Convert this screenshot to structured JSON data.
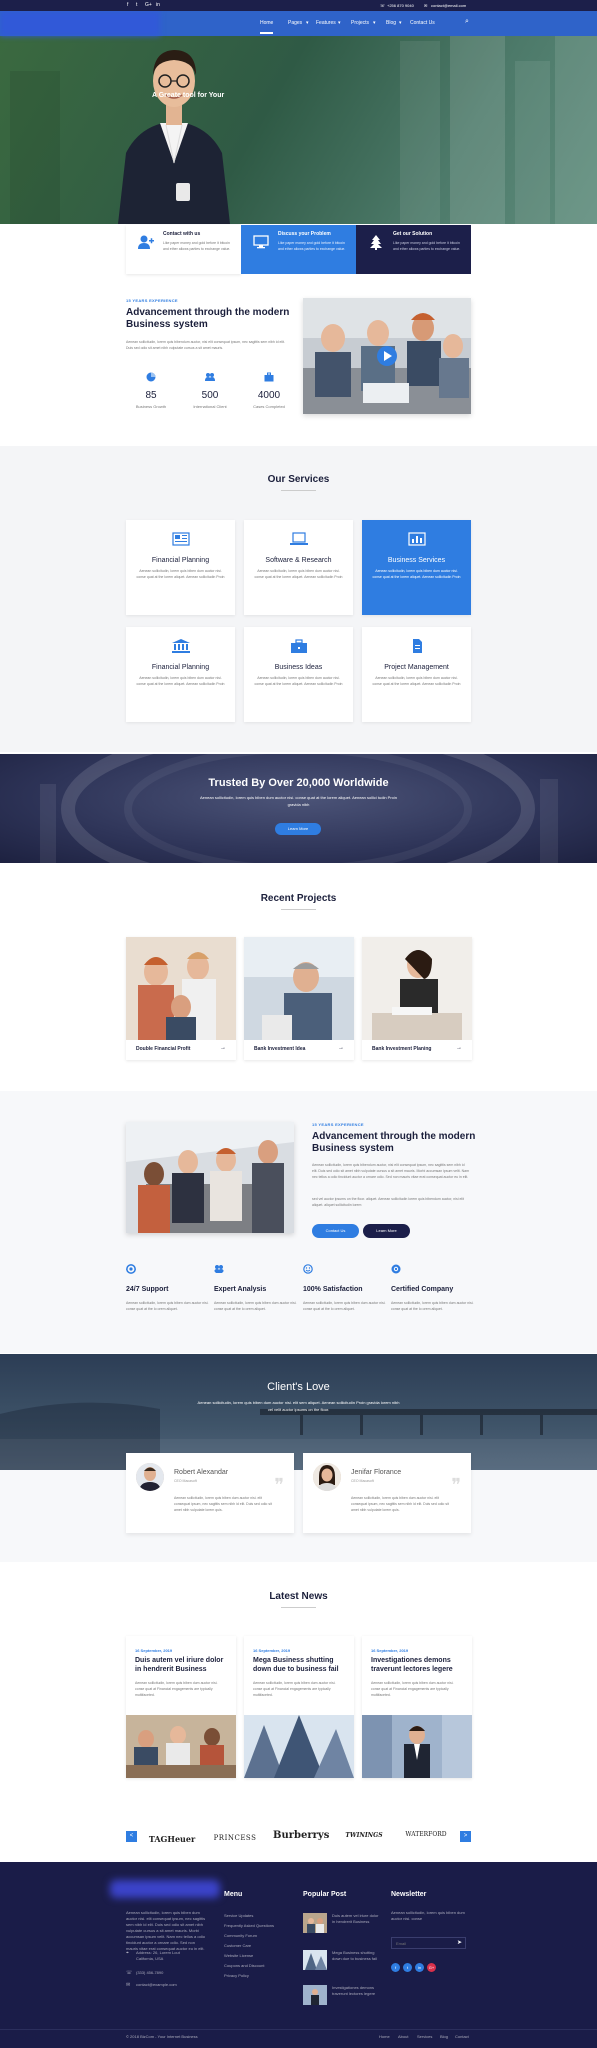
{
  "topbar": {
    "social": [
      "f",
      "t",
      "G+",
      "in"
    ],
    "phone": "+256 870 9040",
    "email": "contact@email.com"
  },
  "nav": {
    "items": [
      "Home",
      "Pages",
      "Features",
      "Projects",
      "Blog",
      "Contact Us"
    ]
  },
  "hero": {
    "headline": "A Greate tool for Your"
  },
  "features": [
    {
      "title": "Contact with us",
      "text": "Like paper money and gold before it bitcoin and ether allows parties to exchange value."
    },
    {
      "title": "Discuss your Problem",
      "text": "Like paper money and gold before it bitcoin and ether allows parties to exchange value."
    },
    {
      "title": "Get our Solution",
      "text": "Like paper money and gold before it bitcoin and ether allows parties to exchange value."
    }
  ],
  "about": {
    "eyebrow": "15 YEARS EXPERIENCE",
    "title_line1": "Advancement through the modern",
    "title_line2": "Business system",
    "text": "Aenean sollicitudin, lorem quis bibendum auctor, nisi elit consequat ipsum, nec sagittis sem nibh id elit. Duis sed odio sit amet nibh vulputate cursus a sit amet mauris.",
    "stats": [
      {
        "value": "85",
        "label": "Business Growth"
      },
      {
        "value": "500",
        "label": "International Client"
      },
      {
        "value": "4000",
        "label": "Cases Completed"
      }
    ]
  },
  "services": {
    "title": "Our Services",
    "items": [
      {
        "title": "Financial Planning",
        "text": "Aenean sollicitudin, lorem quis biben dum auctor nisi. conse quat at the lorem aliquet. Aenean sollicitudin Proin"
      },
      {
        "title": "Software & Research",
        "text": "Aenean sollicitudin, lorem quis biben dum auctor nisi. conse quat at the lorem aliquet. Aenean sollicitudin Proin"
      },
      {
        "title": "Business Services",
        "text": "Aenean sollicitudin, lorem quis biben dum auctor nisi. conse quat at the lorem aliquet. Aenean sollicitudin Proin"
      },
      {
        "title": "Financial Planning",
        "text": "Aenean sollicitudin, lorem quis biben dum auctor nisi. conse quat at the lorem aliquet. Aenean sollicitudin Proin"
      },
      {
        "title": "Business Ideas",
        "text": "Aenean sollicitudin, lorem quis biben dum auctor nisi. conse quat at the lorem aliquet. Aenean sollicitudin Proin"
      },
      {
        "title": "Project Management",
        "text": "Aenean sollicitudin, lorem quis biben dum auctor nisi. conse quat at the lorem aliquet. Aenean sollicitudin Proin"
      }
    ]
  },
  "trust": {
    "title": "Trusted By Over 20,000 Worldwide",
    "text": "Aenean sollicitudin, lorem quis biben dum auctor nisi. conse quat at the lorem aliquet. Aenean sollici tudin Proin gravida nibh",
    "button": "Learn More"
  },
  "projects": {
    "title": "Recent Projects",
    "items": [
      "Double Financial Profit",
      "Bank Investment Idea",
      "Bank Investment Planing"
    ]
  },
  "experience2": {
    "eyebrow": "15 YEARS EXPERIENCE",
    "title_line1": "Advancement through the modern",
    "title_line2": "Business system",
    "text1": "Aenean sollicitudin, lorem quis bibendum auctor, nisi elit consequat ipsum, nec sagittis sem nibh id elit. Duis sed odio sit amet nibh vulputate cursus a sit amet mauris. Morbi accumsan ipsum velit. Nam nec tellus a odio tincidunt auctor a ornare odio. Sed non mauris vitae erat consequat auctor eu in elit.",
    "text2": "sed vel auctor ipsums on the floor. aliquet. Aenean sollicitudin lorem quis bibendum auctor, nisi elit aliquet. aliquet sollicitudin lorem",
    "btn_primary": "Contact Us",
    "btn_secondary": "Learn More",
    "features": [
      {
        "title": "24/7 Support",
        "text": "Aenean sollicitudin, lorem quis biben dum auctor nisi. conse quat at the lo orem aliquet."
      },
      {
        "title": "Expert Analysis",
        "text": "Aenean sollicitudin, lorem quis biben dum auctor nisi. conse quat at the lo orem aliquet."
      },
      {
        "title": "100% Satisfaction",
        "text": "Aenean sollicitudin, lorem quis biben dum auctor nisi. conse quat at the lo orem aliquet."
      },
      {
        "title": "Certified Company",
        "text": "Aenean sollicitudin, lorem quis biben dum auctor nisi. conse quat at the lo orem aliquet."
      }
    ]
  },
  "clients": {
    "title": "Client's Love",
    "text": "Aenean sollicitudin, lorem quis biben dum auctor nisi. elit sem aliquet. Aenean sollicitudin Proin gravida lorem nibh vel velit auctor ipsums on the floor.",
    "items": [
      {
        "name": "Robert Alexandar",
        "role": "CEO Macasoft",
        "quote": "Aenean sollicitudin, lorem quis biben dum auctor nisi. elit consequat ipsum, nec sagittis sem nibh id elit. Duis sed odio sit amet nibh vulputate lorem quis."
      },
      {
        "name": "Jenifar Florance",
        "role": "CEO Macasoft",
        "quote": "Aenean sollicitudin, lorem quis biben dum auctor nisi. elit consequat ipsum, nec sagittis sem nibh id elit. Duis sed odio sit amet nibh vulputate lorem quis."
      }
    ]
  },
  "news": {
    "title": "Latest News",
    "items": [
      {
        "date": "16 September, 2019",
        "title": "Duis autem vel iriure dolor in hendrerit Business",
        "text": "Aenean sollicitudin, lorem quis biben dum auctor nisi. conse quat at Financial engagements are typically multifaceted."
      },
      {
        "date": "16 September, 2019",
        "title": "Mega Business shutting down due to business fail",
        "text": "Aenean sollicitudin, lorem quis biben dum auctor nisi. conse quat at Financial engagements are typically multifaceted."
      },
      {
        "date": "16 September, 2019",
        "title": "Investigationes demons traverunt lectores legere",
        "text": "Aenean sollicitudin, lorem quis biben dum auctor nisi. conse quat at Financial engagements are typically multifaceted."
      }
    ]
  },
  "brands": {
    "prev": "<",
    "next": ">",
    "items": [
      "TAGHeuer",
      "PRINCESS",
      "Burberrys",
      "TWININGS",
      "WATERFORD"
    ]
  },
  "footer": {
    "about_text": "Aenean sollicitudin, lorem quis biben dum auctor nisi. elit consequat ipsum, nec sagittis sem nibh id elit. Duis sed odio sit amet nibh vulputate cursus a sit amet mauris. Morbi accumsan ipsum velit. Nam nec tellus a odio tincidunt auctor a ornare odio. Sed non mauris vitae erat consequat auctor eu in elit.",
    "address": "Address: 26, Lorem Lout California, USA",
    "phone": "(333) 456-7890",
    "email": "contact@example.com",
    "menu_title": "Menu",
    "menu": [
      "Service Updates",
      "Frequently Asked Questions",
      "Community Forum",
      "Customer Care",
      "Website License",
      "Coupons and Discount",
      "Privacy Policy"
    ],
    "popular_title": "Popular Post",
    "popular": [
      "Duis autem vel iriure dolor in hendrerit Business",
      "Mega Business shutting down due to business fail",
      "Investigationes demons traverunt lectores legere"
    ],
    "newsletter_title": "Newsletter",
    "newsletter_text": "Aenean sollicitudin, lorem quis biben dum auctor nisi. conse",
    "email_placeholder": "Email",
    "social": [
      "f",
      "t",
      "in",
      "G+"
    ],
    "copyright": "© 2018 BizCom - Your Internet Business",
    "bottom_links": [
      "Home",
      "About",
      "Services",
      "Blog",
      "Contact"
    ]
  }
}
